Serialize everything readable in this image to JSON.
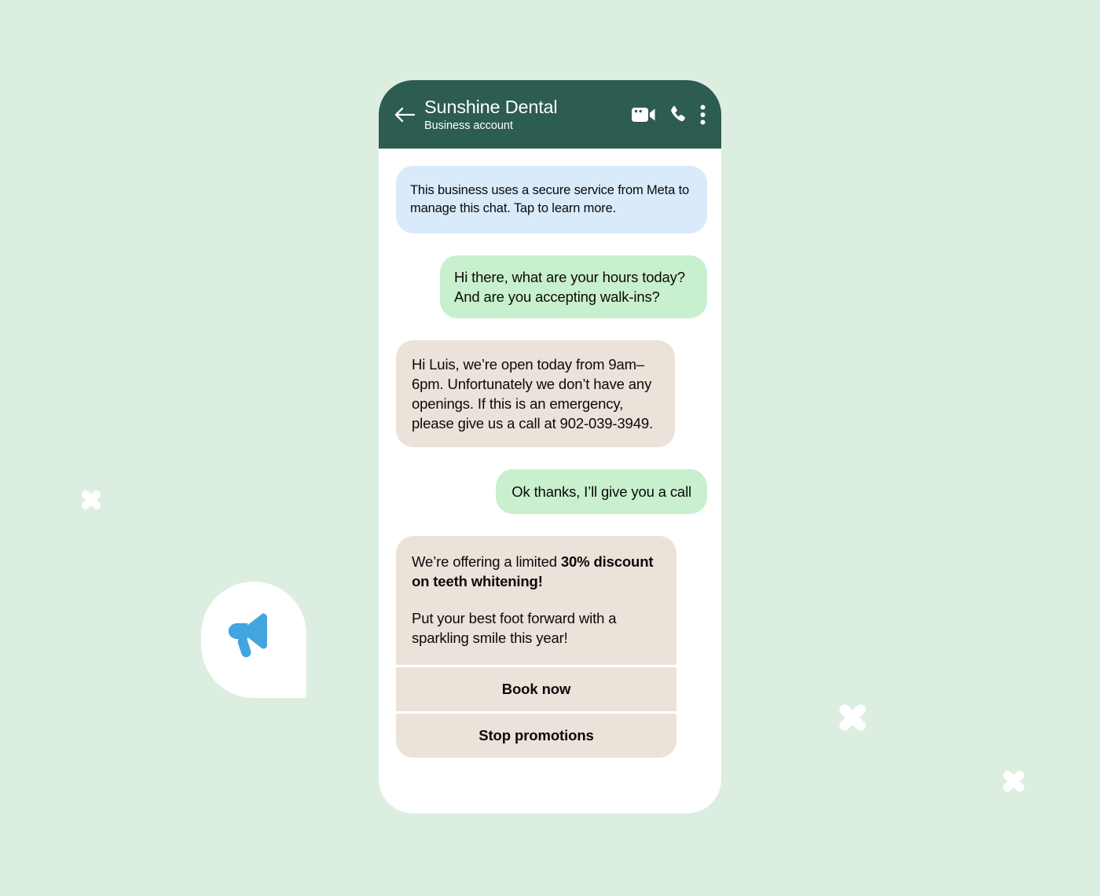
{
  "theme": {
    "page_background": "#dceee0",
    "header_green": "#2d5c50",
    "system_bubble": "#d9eafb",
    "user_bubble": "#c9f0ce",
    "business_bubble": "#ebe2da",
    "megaphone_blue": "#41a5e0",
    "phone_surface": "#ffffff",
    "text_primary": "#0a0a0a"
  },
  "decor": {
    "megaphone_icon": "megaphone-icon",
    "x_marks": [
      "x-mark-left",
      "x-mark-right-upper",
      "x-mark-right-lower"
    ]
  },
  "header": {
    "back_icon": "back-arrow-icon",
    "title": "Sunshine Dental",
    "subtitle": "Business account",
    "video_call_icon": "video-camera-icon",
    "voice_call_icon": "phone-icon",
    "overflow_icon": "more-vertical-icon"
  },
  "conversation": {
    "messages": [
      {
        "id": "system-notice",
        "sender": "system",
        "text": "This business uses a secure service from Meta to manage this chat. Tap to learn more."
      },
      {
        "id": "user-question",
        "sender": "user",
        "text": "Hi there, what are your hours today? And are you accepting walk-ins?"
      },
      {
        "id": "business-reply",
        "sender": "business",
        "text": "Hi Luis, we’re open today from 9am–6pm. Unfortunately we don’t have any openings. If this is an emergency, please give us a call at 902-039-3949."
      },
      {
        "id": "user-ack",
        "sender": "user",
        "text": "Ok thanks, I’ll give you a call"
      }
    ],
    "promo_card": {
      "id": "promo-card",
      "paragraph_1_lead": "We’re offering a limited ",
      "paragraph_1_bold": "30% discount on teeth whitening!",
      "paragraph_2": "Put your best foot forward with a sparkling smile this year!",
      "buttons": [
        {
          "id": "book-now",
          "label": "Book now"
        },
        {
          "id": "stop-promotions",
          "label": "Stop promotions"
        }
      ]
    }
  }
}
